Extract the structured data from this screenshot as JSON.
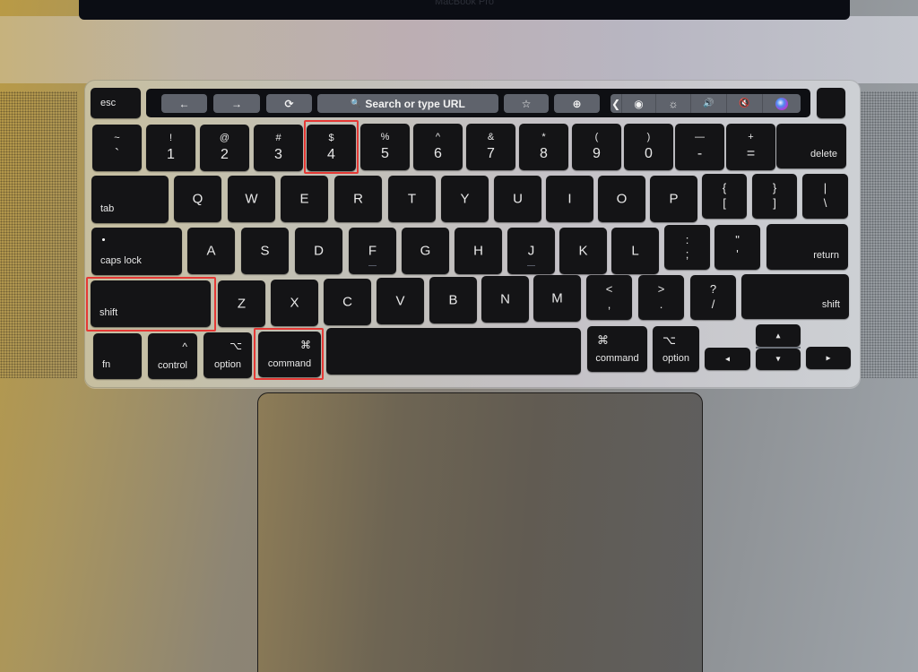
{
  "scene": {
    "description": "MacBook Pro keyboard with Touch Bar; highlighted keys for screenshot shortcut",
    "bezel_label": "MacBook Pro",
    "highlight_color": "#e53935",
    "highlighted_keys": [
      "shift",
      "command",
      "4"
    ]
  },
  "touchbar": {
    "back_icon": "←",
    "forward_icon": "→",
    "reload_icon": "⟳",
    "search_icon": "🔍",
    "search_label": "Search or type URL",
    "bookmark_icon": "☆",
    "new_tab_icon": "⊕",
    "expand_icon": "❮",
    "screenshot_icon": "◉",
    "brightness_icon": "☼",
    "volume_icon": "🔊",
    "mute_icon": "🔇",
    "siri_label": ""
  },
  "keys": {
    "esc": "esc",
    "row1": [
      {
        "top": "~",
        "bottom": "`"
      },
      {
        "top": "!",
        "bottom": "1"
      },
      {
        "top": "@",
        "bottom": "2"
      },
      {
        "top": "#",
        "bottom": "3"
      },
      {
        "top": "$",
        "bottom": "4"
      },
      {
        "top": "%",
        "bottom": "5"
      },
      {
        "top": "^",
        "bottom": "6"
      },
      {
        "top": "&",
        "bottom": "7"
      },
      {
        "top": "*",
        "bottom": "8"
      },
      {
        "top": "(",
        "bottom": "9"
      },
      {
        "top": ")",
        "bottom": "0"
      },
      {
        "top": "—",
        "bottom": "-"
      },
      {
        "top": "+",
        "bottom": "="
      }
    ],
    "delete": "delete",
    "tab": "tab",
    "row2": [
      "Q",
      "W",
      "E",
      "R",
      "T",
      "Y",
      "U",
      "I",
      "O",
      "P"
    ],
    "row2_symbols": [
      {
        "top": "{",
        "bottom": "["
      },
      {
        "top": "}",
        "bottom": "]"
      },
      {
        "top": "|",
        "bottom": "\\"
      }
    ],
    "caps_lock": "caps lock",
    "row3": [
      "A",
      "S",
      "D",
      "F",
      "G",
      "H",
      "J",
      "K",
      "L"
    ],
    "row3_symbols": [
      {
        "top": ":",
        "bottom": ";"
      },
      {
        "top": "\"",
        "bottom": "'"
      }
    ],
    "return": "return",
    "shift_left": "shift",
    "row4": [
      "Z",
      "X",
      "C",
      "V",
      "B",
      "N",
      "M"
    ],
    "row4_symbols": [
      {
        "top": "<",
        "bottom": ","
      },
      {
        "top": ">",
        "bottom": "."
      },
      {
        "top": "?",
        "bottom": "/"
      }
    ],
    "shift_right": "shift",
    "fn": "fn",
    "control": {
      "symbol": "^",
      "label": "control"
    },
    "option_left": {
      "symbol": "⌥",
      "label": "option"
    },
    "command_left": {
      "symbol": "⌘",
      "label": "command"
    },
    "command_right": {
      "symbol": "⌘",
      "label": "command"
    },
    "option_right": {
      "symbol": "⌥",
      "label": "option"
    },
    "arrows": {
      "left": "◂",
      "up": "▴",
      "down": "▾",
      "right": "▸"
    }
  }
}
